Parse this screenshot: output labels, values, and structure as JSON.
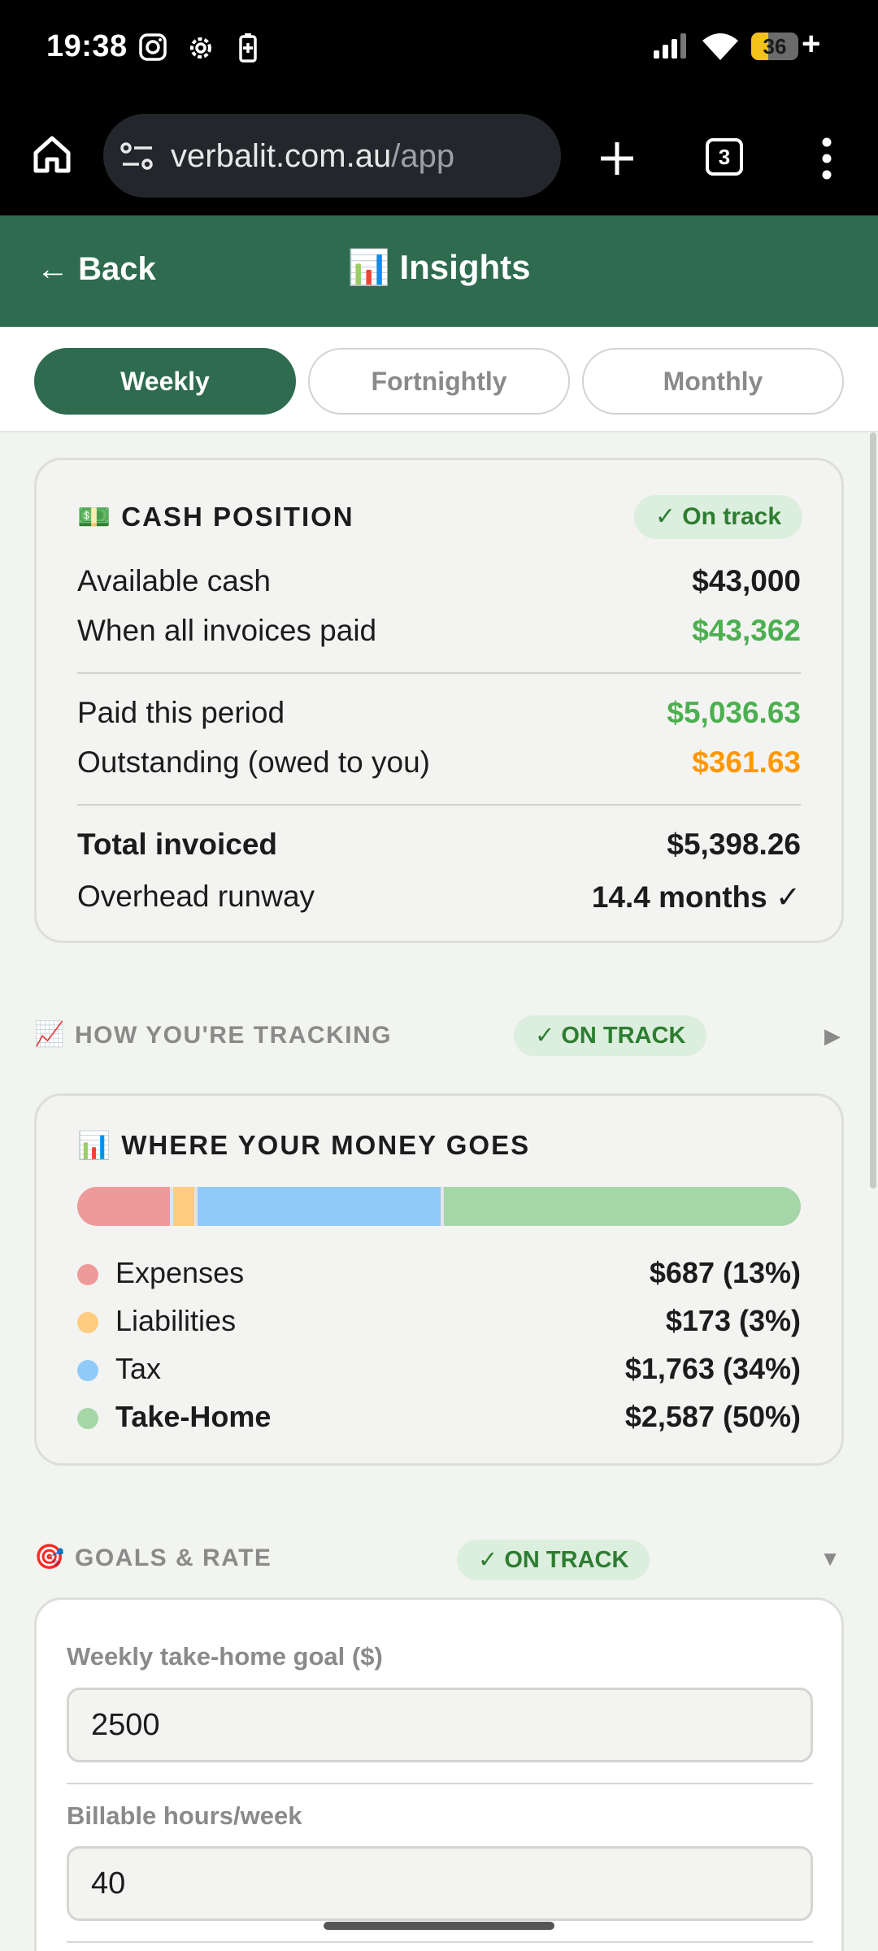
{
  "status_bar": {
    "time": "19:38",
    "battery": "36",
    "battery_plus": "+"
  },
  "browser": {
    "url_domain": "verbalit.com.au",
    "url_path": "/app",
    "tab_count": "3"
  },
  "header": {
    "back_label": "← Back",
    "title": "📊 Insights"
  },
  "period_tabs": [
    {
      "label": "Weekly",
      "active": true
    },
    {
      "label": "Fortnightly",
      "active": false
    },
    {
      "label": "Monthly",
      "active": false
    }
  ],
  "cash_position": {
    "icon": "💵",
    "title": "CASH POSITION",
    "status": "✓ On track",
    "rows": [
      {
        "label": "Available cash",
        "value": "$43,000"
      },
      {
        "label": "When all invoices paid",
        "value": "$43,362"
      },
      {
        "label": "Paid this period",
        "value": "$5,036.63"
      },
      {
        "label": "Outstanding (owed to you)",
        "value": "$361.63"
      },
      {
        "label": "Total invoiced",
        "value": "$5,398.26"
      },
      {
        "label": "Overhead runway",
        "value": "14.4 months ✓"
      }
    ]
  },
  "tracking_section": {
    "icon": "📈",
    "label": "HOW YOU'RE TRACKING",
    "status": "✓ ON TRACK",
    "arrow": "▶"
  },
  "money_goes": {
    "icon": "📊",
    "title": "WHERE YOUR MONEY GOES",
    "items": [
      {
        "label": "Expenses",
        "value": "$687 (13%)",
        "percent": 13,
        "color": "#ef9a9a"
      },
      {
        "label": "Liabilities",
        "value": "$173 (3%)",
        "percent": 3,
        "color": "#ffcc80"
      },
      {
        "label": "Tax",
        "value": "$1,763 (34%)",
        "percent": 34,
        "color": "#90caf9"
      },
      {
        "label": "Take-Home",
        "value": "$2,587 (50%)",
        "percent": 50,
        "color": "#a5d6a7"
      }
    ]
  },
  "goals_section": {
    "icon": "🎯",
    "label": "GOALS & RATE",
    "status": "✓ ON TRACK",
    "arrow": "▼"
  },
  "goals_form": {
    "goal_label": "Weekly take-home goal ($)",
    "goal_value": "2500",
    "hours_label": "Billable hours/week",
    "hours_value": "40"
  },
  "colors": {
    "brand": "#2e6b4f",
    "positive": "#4caf50",
    "warning": "#ff9800"
  }
}
